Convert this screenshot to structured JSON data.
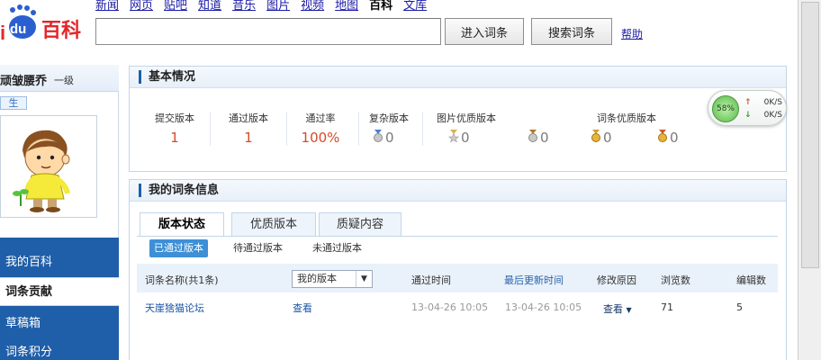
{
  "header": {
    "logo_text": "百科",
    "nav": [
      "新闻",
      "网页",
      "贴吧",
      "知道",
      "音乐",
      "图片",
      "视频",
      "地图",
      "百科",
      "文库"
    ],
    "nav_current_index": 8,
    "search_value": "",
    "enter_button": "进入词条",
    "search_button": "搜索词条",
    "help": "帮助"
  },
  "sidebar": {
    "user_name": "顽皱腰乔",
    "user_level": "一级",
    "badge": "生",
    "menu": [
      {
        "label": "我的百科",
        "active": false
      },
      {
        "label": "词条贡献",
        "active": true
      },
      {
        "label": "草稿箱",
        "active": false
      },
      {
        "label": "词条积分",
        "active": false
      }
    ]
  },
  "basic_info": {
    "title": "基本情况",
    "stats": [
      {
        "label": "提交版本",
        "value": "1"
      },
      {
        "label": "通过版本",
        "value": "1"
      },
      {
        "label": "通过率",
        "value": "100%"
      }
    ],
    "quality": {
      "complex_label": "复杂版本",
      "complex_value": "0",
      "image_label": "图片优质版本",
      "image_value": "0",
      "entry_label": "词条优质版本",
      "entry_values": [
        "0",
        "0",
        "0"
      ]
    }
  },
  "speed_widget": {
    "percent": "58%",
    "up": "0K/S",
    "down": "0K/S"
  },
  "my_entries": {
    "title": "我的词条信息",
    "tabs": [
      "版本状态",
      "优质版本",
      "质疑内容"
    ],
    "active_tab": 0,
    "subtabs": [
      "已通过版本",
      "待通过版本",
      "未通过版本"
    ],
    "active_subtab": 0,
    "table": {
      "headers": {
        "name": "词条名称(共1条)",
        "version_select": "我的版本",
        "pass_time": "通过时间",
        "last_update": "最后更新时间",
        "reason": "修改原因",
        "views": "浏览数",
        "edits": "编辑数"
      },
      "rows": [
        {
          "name": "天崖猞猫论坛",
          "version": "查看",
          "pass_time": "13-04-26 10:05",
          "last_update": "13-04-26 10:05",
          "reason": "查看",
          "views": "71",
          "edits": "5"
        }
      ]
    }
  },
  "colors": {
    "brand_blue": "#1f5ea8",
    "stat_red": "#d64a2a",
    "link_blue": "#1a55a6"
  }
}
